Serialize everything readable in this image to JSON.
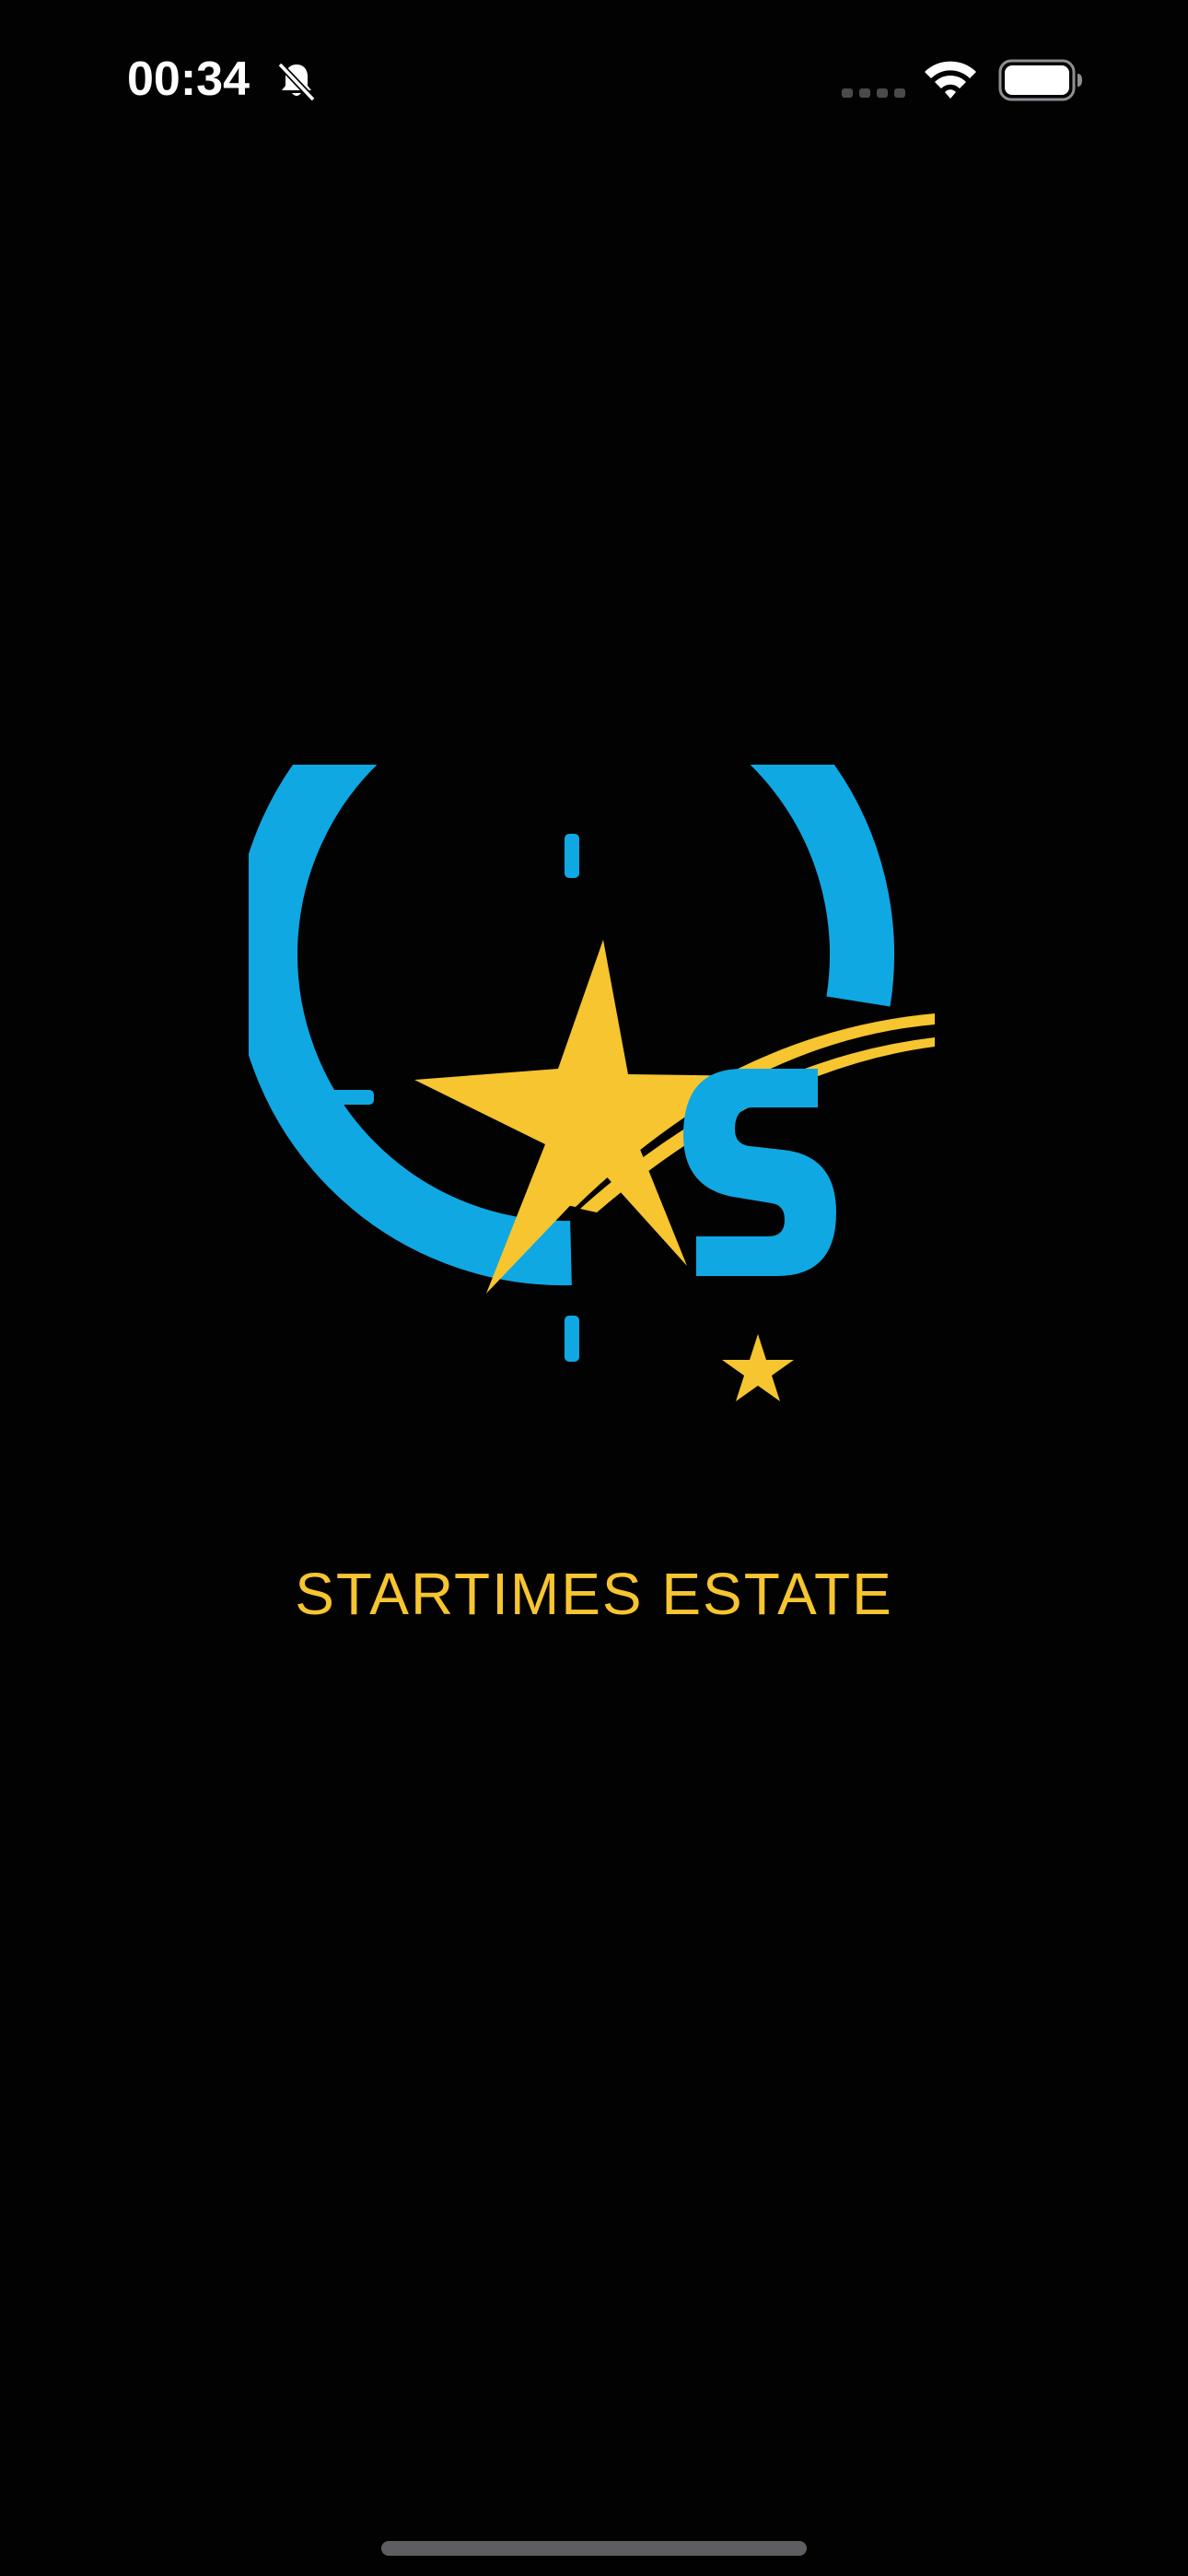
{
  "status_bar": {
    "time": "00:34",
    "icons": [
      "bell-slash-icon",
      "cellular-signal-icon",
      "wifi-icon",
      "battery-icon"
    ]
  },
  "splash": {
    "app_name": "STARTIMES ESTATE",
    "logo_icon": "startimes-estate-logo",
    "colors": {
      "background": "#030203",
      "brand_blue": "#10a8e3",
      "brand_yellow": "#f6c52f"
    }
  }
}
